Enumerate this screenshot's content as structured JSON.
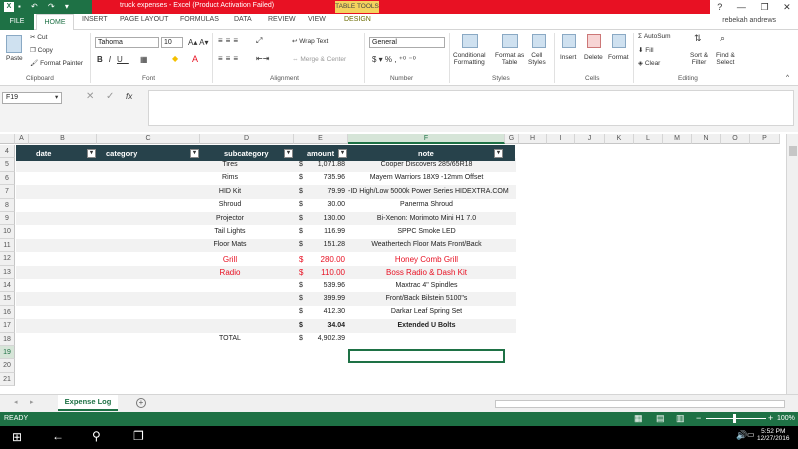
{
  "window": {
    "title": "truck expenses - Excel (Product Activation Failed)",
    "table_tools": "TABLE TOOLS",
    "help": "?",
    "minimize": "—",
    "restore": "❐",
    "close": "✕"
  },
  "tabs": [
    "FILE",
    "HOME",
    "INSERT",
    "PAGE LAYOUT",
    "FORMULAS",
    "DATA",
    "REVIEW",
    "VIEW",
    "DESIGN"
  ],
  "user": "rebekah andrews",
  "ribbon": {
    "clipboard": {
      "paste": "Paste",
      "cut": "Cut",
      "copy": "Copy",
      "format_painter": "Format Painter",
      "label": "Clipboard"
    },
    "font": {
      "name": "Tahoma",
      "size": "10",
      "label": "Font"
    },
    "alignment": {
      "wrap": "Wrap Text",
      "merge": "Merge & Center",
      "label": "Alignment"
    },
    "number": {
      "format": "General",
      "label": "Number"
    },
    "styles": {
      "conditional": "Conditional",
      "formatting": "Formatting",
      "format_as": "Format as",
      "table": "Table",
      "cell": "Cell",
      "styles": "Styles",
      "label": "Styles"
    },
    "cells": {
      "insert": "Insert",
      "delete": "Delete",
      "format": "Format",
      "label": "Cells"
    },
    "editing": {
      "autosum": "AutoSum",
      "fill": "Fill",
      "clear": "Clear",
      "sort": "Sort &",
      "filter": "Filter",
      "find": "Find &",
      "select": "Select",
      "label": "Editing"
    }
  },
  "formula_bar": {
    "name_box": "F19",
    "fx": "fx"
  },
  "columns": [
    "A",
    "B",
    "C",
    "D",
    "E",
    "F",
    "G",
    "H",
    "I",
    "J",
    "K",
    "L",
    "M",
    "N",
    "O",
    "P"
  ],
  "table_headers": {
    "date": "date",
    "category": "category",
    "subcategory": "subcategory",
    "amount": "amount",
    "note": "note"
  },
  "rows": [
    {
      "num": "4"
    },
    {
      "num": "5",
      "sub": "Tires",
      "cur": "$",
      "amt": "1,071.88",
      "note": "Cooper Discovers 285/65R18"
    },
    {
      "num": "6",
      "sub": "Rims",
      "cur": "$",
      "amt": "735.96",
      "note": "Mayem Warriors 18X9 -12mm Offset"
    },
    {
      "num": "7",
      "sub": "HID Kit",
      "cur": "$",
      "amt": "79.99",
      "note": "-ID High/Low 5000k Power Series HIDEXTRA.COM"
    },
    {
      "num": "8",
      "sub": "Shroud",
      "cur": "$",
      "amt": "30.00",
      "note": "Panerma Shroud"
    },
    {
      "num": "9",
      "sub": "Projector",
      "cur": "$",
      "amt": "130.00",
      "note": "Bi-Xenon: Morimoto Mini H1 7.0"
    },
    {
      "num": "10",
      "sub": "Tail Lights",
      "cur": "$",
      "amt": "116.99",
      "note": "SPPC Smoke LED"
    },
    {
      "num": "11",
      "sub": "Floor Mats",
      "cur": "$",
      "amt": "151.28",
      "note": "Weathertech Floor Mats Front/Back"
    },
    {
      "num": "12",
      "sub": "Grill",
      "cur": "$",
      "amt": "280.00",
      "note": "Honey Comb Grill",
      "red": true
    },
    {
      "num": "13",
      "sub": "Radio",
      "cur": "$",
      "amt": "110.00",
      "note": "Boss Radio & Dash Kit",
      "red": true
    },
    {
      "num": "14",
      "sub": "",
      "cur": "$",
      "amt": "539.96",
      "note": "Maxtrac 4\" Spindles"
    },
    {
      "num": "15",
      "sub": "",
      "cur": "$",
      "amt": "399.99",
      "note": "Front/Back Bilstein 5100\"s"
    },
    {
      "num": "16",
      "sub": "",
      "cur": "$",
      "amt": "412.30",
      "note": "Darkar Leaf Spring Set"
    },
    {
      "num": "17",
      "sub": "",
      "cur": "$",
      "amt": "34.04",
      "note": "Extended U Bolts"
    },
    {
      "num": "18",
      "sub": "TOTAL",
      "cur": "$",
      "amt": "4,902.39",
      "note": ""
    },
    {
      "num": "19"
    },
    {
      "num": "20"
    },
    {
      "num": "21"
    }
  ],
  "sheet_tab": "Expense Log",
  "status": {
    "ready": "READY",
    "zoom": "100%"
  },
  "taskbar": {
    "time": "5:52 PM",
    "date": "12/27/2016"
  },
  "colors": {
    "excel_green": "#1e7145",
    "header_dark": "#27424b",
    "red": "#e81123"
  }
}
